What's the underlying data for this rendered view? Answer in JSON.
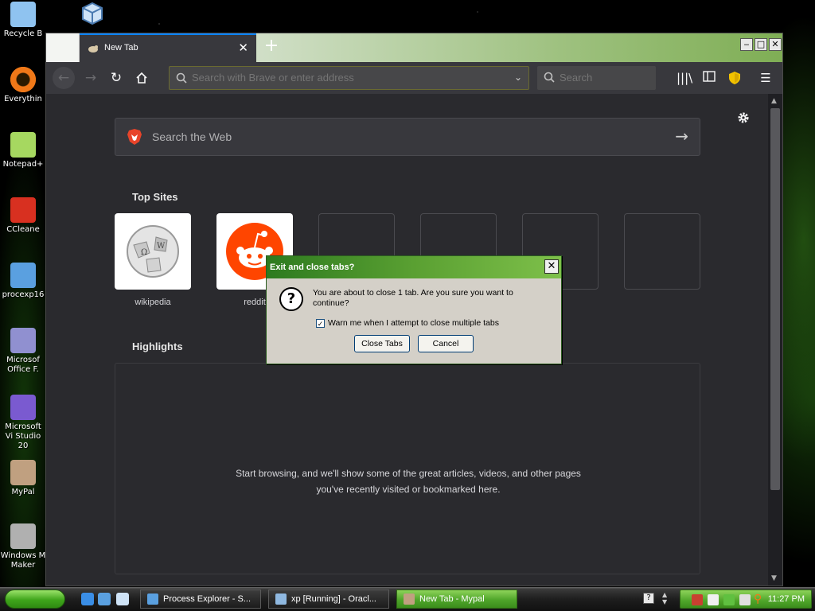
{
  "desktop": {
    "icons": [
      {
        "label": "Recycle B",
        "icon": "recycle-bin-icon",
        "color": "#8fc3f0"
      },
      {
        "label": "Everythin",
        "icon": "everything-icon",
        "color": "#f07818"
      },
      {
        "label": "Notepad+",
        "icon": "notepad-plus-icon",
        "color": "#a6d860"
      },
      {
        "label": "CCleane",
        "icon": "ccleaner-icon",
        "color": "#d83020"
      },
      {
        "label": "procexp16",
        "icon": "process-explorer-icon",
        "color": "#5aa0e0"
      },
      {
        "label": "Microsof Office F.",
        "icon": "office-icon",
        "color": "#9090d0"
      },
      {
        "label": "Microsoft Vi Studio 20",
        "icon": "visual-studio-icon",
        "color": "#7a5ad0"
      },
      {
        "label": "MyPal",
        "icon": "mypal-icon",
        "color": "#c0a080"
      },
      {
        "label": "Windows M Maker",
        "icon": "movie-maker-icon",
        "color": "#b0b0b0"
      }
    ]
  },
  "browser": {
    "tab_title": "New Tab",
    "new_tab_symbol": "+",
    "url_placeholder": "Search with Brave or enter address",
    "search_placeholder": "Search",
    "web_search_placeholder": "Search the Web",
    "top_sites_heading": "Top Sites",
    "top_sites": [
      {
        "label": "wikipedia",
        "filled": true
      },
      {
        "label": "reddit",
        "filled": true
      },
      {
        "label": "",
        "filled": false
      },
      {
        "label": "",
        "filled": false
      },
      {
        "label": "",
        "filled": false
      },
      {
        "label": "",
        "filled": false
      }
    ],
    "highlights_heading": "Highlights",
    "highlights_message": "Start browsing, and we'll show some of the great articles, videos, and other pages you've recently visited or bookmarked here.",
    "accent_color": "#0a84ff"
  },
  "dialog": {
    "title": "Exit and close tabs?",
    "message": "You are about to close 1 tab. Are you sure you want to continue?",
    "checkbox_label": "Warn me when I attempt to close multiple tabs",
    "checkbox_checked": true,
    "close_tabs_label": "Close Tabs",
    "cancel_label": "Cancel"
  },
  "taskbar": {
    "tasks": [
      {
        "label": "Process Explorer - S...",
        "active": false
      },
      {
        "label": "xp [Running] - Oracl...",
        "active": false
      },
      {
        "label": "New Tab - Mypal",
        "active": true
      }
    ],
    "clock": "11:27 PM"
  }
}
